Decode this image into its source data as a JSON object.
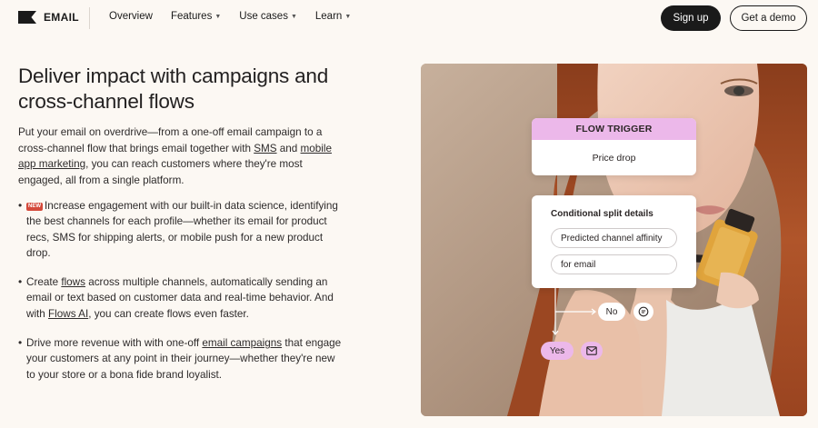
{
  "nav": {
    "logo_text": "EMAIL",
    "links": [
      {
        "label": "Overview",
        "dropdown": false
      },
      {
        "label": "Features",
        "dropdown": true
      },
      {
        "label": "Use cases",
        "dropdown": true
      },
      {
        "label": "Learn",
        "dropdown": true
      }
    ],
    "signup_label": "Sign up",
    "demo_label": "Get a demo"
  },
  "hero": {
    "headline": "Deliver impact with campaigns and cross-channel flows",
    "intro": {
      "part1": "Put your email on overdrive—from a one-off email campaign to a cross-channel flow that brings email together with ",
      "link_sms": "SMS",
      "part2": " and ",
      "link_mobile": "mobile app marketing",
      "part3": ", you can reach customers where they're most engaged, all from a single platform."
    },
    "bullets": [
      {
        "badge": "NEW",
        "text": "Increase engagement with our built-in data science, identifying the best channels for each profile—whether its email for product recs, SMS for shipping alerts, or mobile push for a new product drop."
      },
      {
        "pre": "Create ",
        "link1": "flows",
        "mid": " across multiple channels, automatically sending an email or text based on customer data and real-time behavior. And with ",
        "link2": "Flows AI",
        "post": ", you can create flows even faster."
      },
      {
        "pre": "Drive more revenue with with one-off ",
        "link1": "email campaigns",
        "post": " that engage your customers at any point in their journey—whether they're new to your store or a bona fide brand loyalist."
      }
    ]
  },
  "flow": {
    "trigger_title": "FLOW TRIGGER",
    "trigger_value": "Price drop",
    "split_title": "Conditional split details",
    "split_field1": "Predicted channel affinity",
    "split_field2": "for email",
    "no_label": "No",
    "no_icon": "sms-bubble-icon",
    "yes_label": "Yes",
    "yes_icon": "envelope-icon"
  },
  "colors": {
    "background": "#fcf8f3",
    "accent_pink": "#ecb8ea",
    "dark": "#1a1a1a",
    "new_badge": "#d4493a"
  }
}
